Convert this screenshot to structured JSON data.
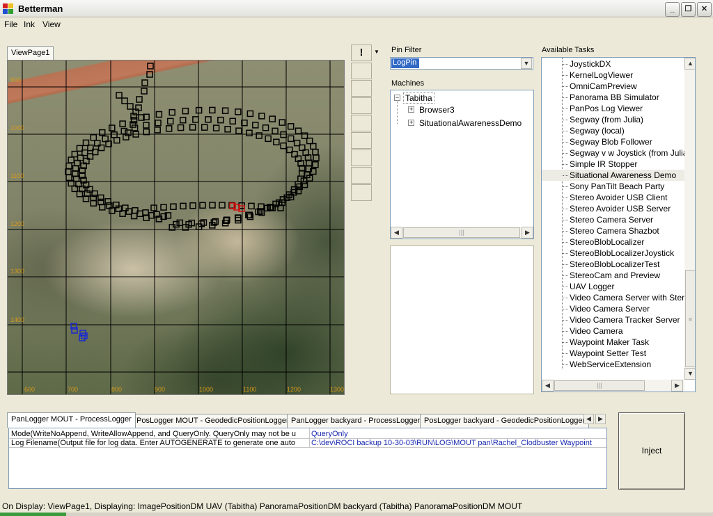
{
  "window": {
    "title": "Betterman",
    "icon": "app-grid-icon"
  },
  "menu": {
    "file": "File",
    "ink": "Ink",
    "view": "View"
  },
  "view_tab": {
    "label": "ViewPage1"
  },
  "map": {
    "y_ticks": [
      "900",
      "1000",
      "1100",
      "1200",
      "1300",
      "1400"
    ],
    "x_ticks": [
      "600",
      "700",
      "800",
      "900",
      "1000",
      "1100",
      "1200",
      "1300"
    ],
    "tick_color": "#d79a1a",
    "track_color": "#000000",
    "uav_color": "#d01010",
    "marker_color": "#1a2ad0"
  },
  "toolbar": {
    "pin_icon": "exclamation-icon",
    "dropdown_icon": "dropdown-arrow-icon"
  },
  "pin_filter": {
    "label": "Pin Filter",
    "value": "LogPin"
  },
  "machines": {
    "label": "Machines",
    "root": "Tabitha",
    "children": [
      "Browser3",
      "SituationalAwarenessDemo"
    ]
  },
  "tasks": {
    "label": "Available Tasks",
    "items": [
      "JoystickDX",
      "KernelLogViewer",
      "OmniCamPreview",
      "Panorama BB Simulator",
      "PanPos Log Viewer",
      "Segway (from Julia)",
      "Segway (local)",
      "Segway Blob Follower",
      "Segway v w Joystick (from Julia)",
      "Simple IR Stopper",
      "Situational Awareness Demo",
      "Sony PanTilt Beach Party",
      "Stereo Avoider USB Client",
      "Stereo Avoider USB Server",
      "Stereo Camera Server",
      "Stereo Camera Shazbot",
      "StereoBlobLocalizer",
      "StereoBlobLocalizerJoystick",
      "StereoBlobLocalizerTest",
      "StereoCam and Preview",
      "UAV Logger",
      "Video Camera Server with Stereo",
      "Video Camera Server",
      "Video Camera Tracker Server",
      "Video Camera",
      "Waypoint Maker Task",
      "Waypoint Setter Test",
      "WebServiceExtension"
    ]
  },
  "bottom_tabs": [
    "PanLogger MOUT - ProcessLogger",
    "PosLogger MOUT - GeodedicPositionLogger",
    "PanLogger backyard - ProcessLogger",
    "PosLogger backyard - GeodedicPositionLogger"
  ],
  "params": [
    {
      "name": "Mode(WriteNoAppend, WriteAllowAppend, and QueryOnly. QueryOnly may not be u",
      "value": "QueryOnly"
    },
    {
      "name": "Log Filename(Output file for log data. Enter AUTOGENERATE to generate one auto",
      "value": "C:\\dev\\ROCI backup 10-30-03\\RUN\\LOG\\MOUT pan\\Rachel_Clodbuster Waypoint"
    }
  ],
  "inject_label": "Inject",
  "status": "On Display: ViewPage1, Displaying: ImagePositionDM UAV (Tabitha) PanoramaPositionDM backyard (Tabitha) PanoramaPositionDM MOUT"
}
